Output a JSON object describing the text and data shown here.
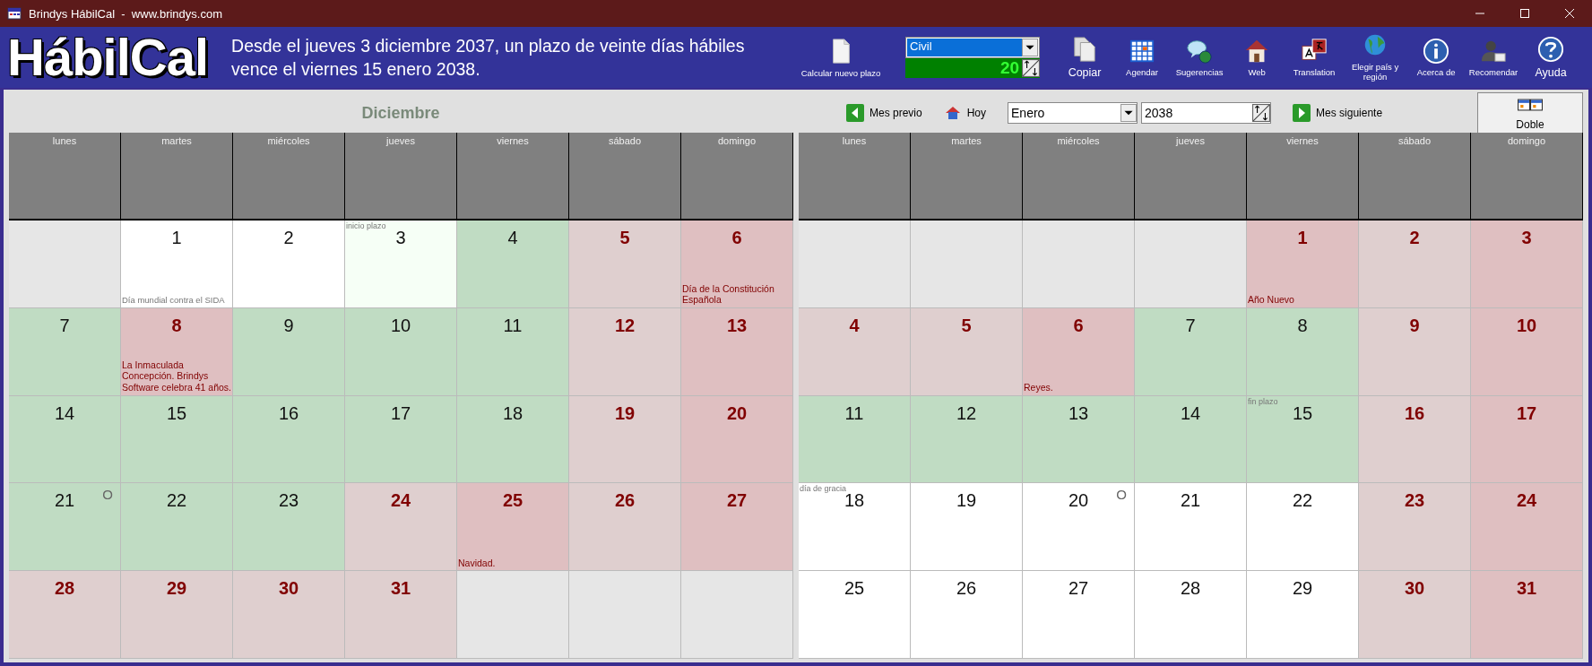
{
  "window": {
    "title": "Brindys HábilCal  -  www.brindys.com"
  },
  "header": {
    "logo": "HábilCal",
    "message": "Desde el jueves 3 diciembre 2037, un plazo de veinte días hábiles vence el viernes 15 enero 2038.",
    "new_calc": "Calcular nuevo plazo",
    "mode": "Civil",
    "day_count": "20",
    "tools": [
      "Copiar",
      "Agendar",
      "Sugerencias",
      "Web",
      "Translation",
      "Elegir país y región",
      "Acerca de",
      "Recomendar",
      "Ayuda"
    ]
  },
  "nav": {
    "month_title": "Diciembre",
    "prev": "Mes previo",
    "today": "Hoy",
    "month": "Enero",
    "year": "2038",
    "next": "Mes siguiente",
    "double": {
      "label": "Doble",
      "selected": true
    }
  },
  "calendars": [
    {
      "weekdays": [
        "lunes",
        "martes",
        "miércoles",
        "jueves",
        "viernes",
        "sábado",
        "domingo"
      ],
      "weeks": [
        [
          {
            "kind": "empty"
          },
          {
            "kind": "plain",
            "day": "1",
            "note": "Día mundial contra el SIDA"
          },
          {
            "kind": "plain",
            "day": "2"
          },
          {
            "kind": "start",
            "day": "3",
            "tag": "inicio plazo"
          },
          {
            "kind": "business",
            "day": "4"
          },
          {
            "kind": "rest",
            "day": "5"
          },
          {
            "kind": "holiday",
            "day": "6",
            "note": "Día de la Constitución Española"
          }
        ],
        [
          {
            "kind": "business",
            "day": "7"
          },
          {
            "kind": "holiday",
            "day": "8",
            "note": "La Inmaculada Concepción. Brindys Software celebra 41 años."
          },
          {
            "kind": "business",
            "day": "9"
          },
          {
            "kind": "business",
            "day": "10"
          },
          {
            "kind": "business",
            "day": "11"
          },
          {
            "kind": "rest",
            "day": "12"
          },
          {
            "kind": "holiday",
            "day": "13"
          }
        ],
        [
          {
            "kind": "business",
            "day": "14"
          },
          {
            "kind": "business",
            "day": "15"
          },
          {
            "kind": "business",
            "day": "16"
          },
          {
            "kind": "business",
            "day": "17"
          },
          {
            "kind": "business",
            "day": "18"
          },
          {
            "kind": "rest",
            "day": "19"
          },
          {
            "kind": "holiday",
            "day": "20"
          }
        ],
        [
          {
            "kind": "business",
            "day": "21",
            "moon": "O"
          },
          {
            "kind": "business",
            "day": "22"
          },
          {
            "kind": "business",
            "day": "23"
          },
          {
            "kind": "rest",
            "day": "24"
          },
          {
            "kind": "holiday",
            "day": "25",
            "note": "Navidad."
          },
          {
            "kind": "rest",
            "day": "26"
          },
          {
            "kind": "holiday",
            "day": "27"
          }
        ],
        [
          {
            "kind": "rest",
            "day": "28"
          },
          {
            "kind": "rest",
            "day": "29"
          },
          {
            "kind": "rest",
            "day": "30"
          },
          {
            "kind": "rest",
            "day": "31"
          },
          {
            "kind": "empty"
          },
          {
            "kind": "empty"
          },
          {
            "kind": "empty"
          }
        ]
      ]
    },
    {
      "weekdays": [
        "lunes",
        "martes",
        "miércoles",
        "jueves",
        "viernes",
        "sábado",
        "domingo"
      ],
      "weeks": [
        [
          {
            "kind": "empty"
          },
          {
            "kind": "empty"
          },
          {
            "kind": "empty"
          },
          {
            "kind": "empty"
          },
          {
            "kind": "holiday",
            "day": "1",
            "note": "Año Nuevo"
          },
          {
            "kind": "rest",
            "day": "2"
          },
          {
            "kind": "holiday",
            "day": "3"
          }
        ],
        [
          {
            "kind": "rest",
            "day": "4"
          },
          {
            "kind": "rest",
            "day": "5"
          },
          {
            "kind": "holiday",
            "day": "6",
            "note": "Reyes."
          },
          {
            "kind": "business",
            "day": "7"
          },
          {
            "kind": "business",
            "day": "8"
          },
          {
            "kind": "rest",
            "day": "9"
          },
          {
            "kind": "holiday",
            "day": "10"
          }
        ],
        [
          {
            "kind": "business",
            "day": "11"
          },
          {
            "kind": "business",
            "day": "12"
          },
          {
            "kind": "business",
            "day": "13"
          },
          {
            "kind": "business",
            "day": "14"
          },
          {
            "kind": "business",
            "day": "15",
            "tag": "fin plazo"
          },
          {
            "kind": "rest",
            "day": "16"
          },
          {
            "kind": "holiday",
            "day": "17"
          }
        ],
        [
          {
            "kind": "plain",
            "day": "18",
            "tag": "día de gracia"
          },
          {
            "kind": "plain",
            "day": "19"
          },
          {
            "kind": "plain",
            "day": "20",
            "moon": "O"
          },
          {
            "kind": "plain",
            "day": "21"
          },
          {
            "kind": "plain",
            "day": "22"
          },
          {
            "kind": "rest",
            "day": "23"
          },
          {
            "kind": "holiday",
            "day": "24"
          }
        ],
        [
          {
            "kind": "plain",
            "day": "25"
          },
          {
            "kind": "plain",
            "day": "26"
          },
          {
            "kind": "plain",
            "day": "27"
          },
          {
            "kind": "plain",
            "day": "28"
          },
          {
            "kind": "plain",
            "day": "29"
          },
          {
            "kind": "rest",
            "day": "30"
          },
          {
            "kind": "holiday",
            "day": "31"
          }
        ]
      ]
    }
  ]
}
